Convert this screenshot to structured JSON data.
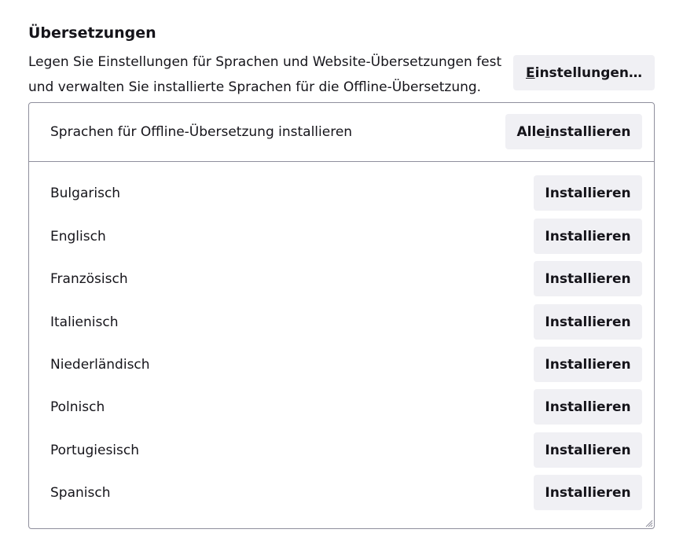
{
  "section": {
    "title": "Übersetzungen",
    "description": "Legen Sie Einstellungen für Sprachen und Website-Übersetzungen fest und verwalten Sie installierte Sprachen für die Offline-Übersetzung.",
    "settings_button": {
      "accesskey": "E",
      "rest": "instellungen…"
    }
  },
  "offline": {
    "header_label": "Sprachen für Offline-Übersetzung installieren",
    "install_all_button": {
      "before": "Alle ",
      "accesskey": "i",
      "after": "nstallieren"
    },
    "languages": [
      {
        "name": "Bulgarisch",
        "action": "Installieren"
      },
      {
        "name": "Englisch",
        "action": "Installieren"
      },
      {
        "name": "Französisch",
        "action": "Installieren"
      },
      {
        "name": "Italienisch",
        "action": "Installieren"
      },
      {
        "name": "Niederländisch",
        "action": "Installieren"
      },
      {
        "name": "Polnisch",
        "action": "Installieren"
      },
      {
        "name": "Portugiesisch",
        "action": "Installieren"
      },
      {
        "name": "Spanisch",
        "action": "Installieren"
      }
    ]
  }
}
